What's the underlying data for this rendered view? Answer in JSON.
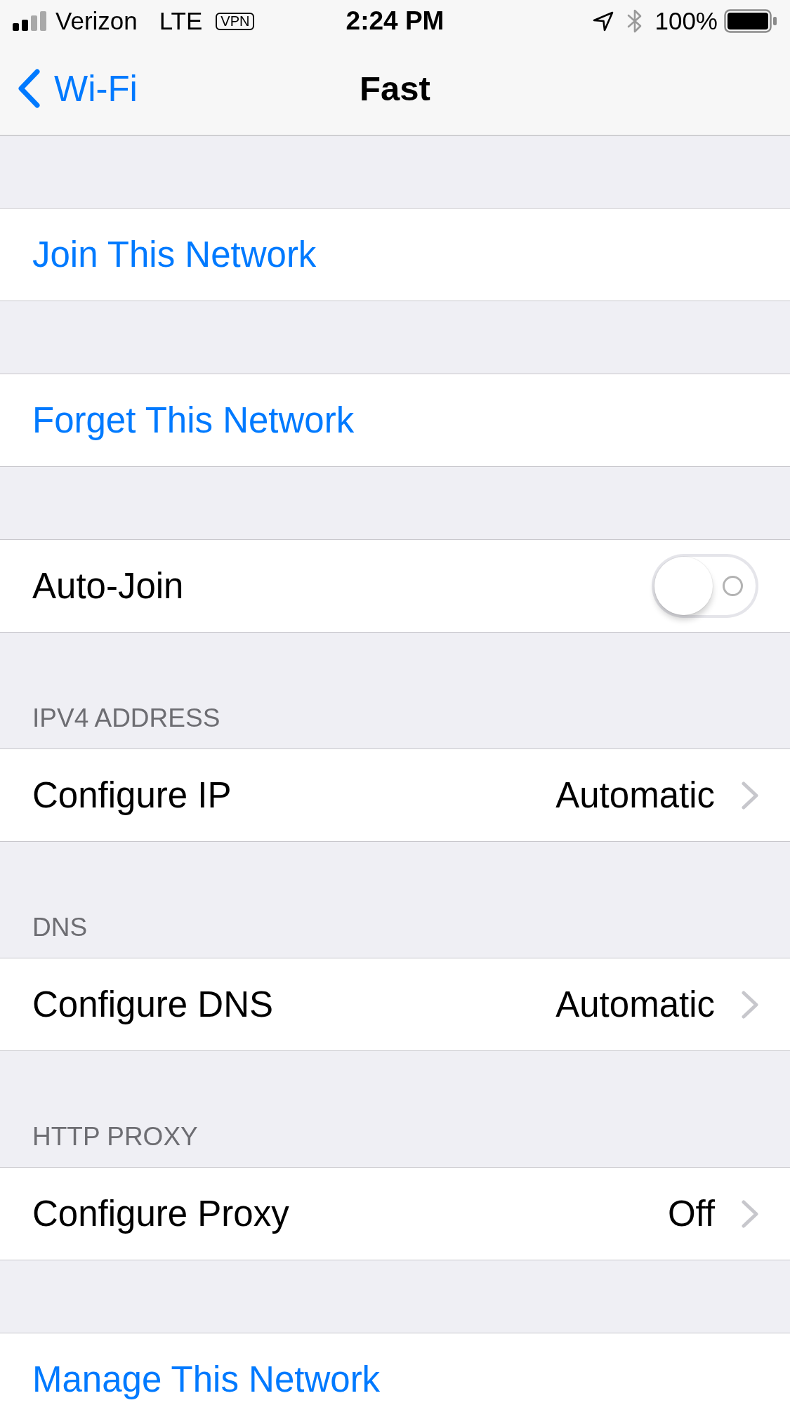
{
  "status_bar": {
    "carrier": "Verizon",
    "network": "LTE",
    "vpn": "VPN",
    "time": "2:24 PM",
    "battery": "100%"
  },
  "nav_bar": {
    "back": "Wi-Fi",
    "title": "Fast"
  },
  "sections": [
    {
      "rows": [
        {
          "kind": "action",
          "label": "Join This Network"
        }
      ]
    },
    {
      "rows": [
        {
          "kind": "action",
          "label": "Forget This Network"
        }
      ]
    },
    {
      "rows": [
        {
          "kind": "toggle",
          "label": "Auto-Join",
          "on": false
        }
      ]
    },
    {
      "header": "IPV4 ADDRESS",
      "rows": [
        {
          "kind": "disclosure",
          "label": "Configure IP",
          "value": "Automatic"
        }
      ]
    },
    {
      "header": "DNS",
      "rows": [
        {
          "kind": "disclosure",
          "label": "Configure DNS",
          "value": "Automatic"
        }
      ]
    },
    {
      "header": "HTTP PROXY",
      "rows": [
        {
          "kind": "disclosure",
          "label": "Configure Proxy",
          "value": "Off"
        }
      ]
    },
    {
      "rows": [
        {
          "kind": "action",
          "label": "Manage This Network"
        }
      ]
    }
  ]
}
